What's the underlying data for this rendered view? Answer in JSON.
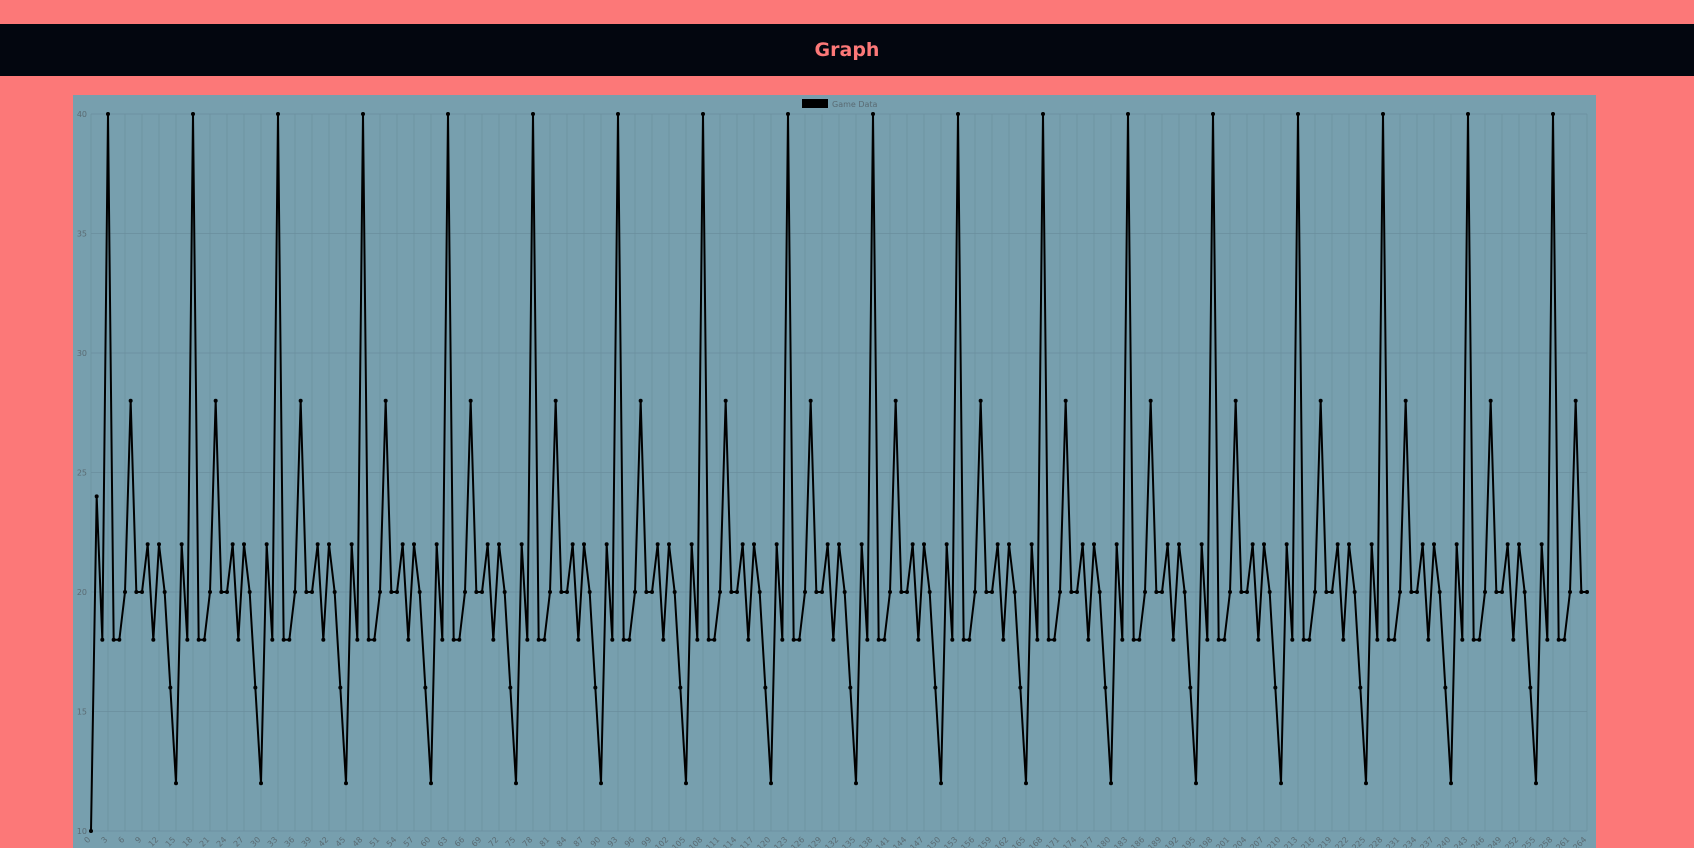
{
  "header": {
    "title": "Graph"
  },
  "colors": {
    "page_background": "#fc7878",
    "header_background": "#03060f",
    "header_text": "#fc7878",
    "chart_background": "#779fae",
    "line": "#000000",
    "grid": "#6a8e9c"
  },
  "chart_data": {
    "type": "line",
    "legend": {
      "label": "Game Data",
      "position": "top"
    },
    "grid": true,
    "ylim": [
      10,
      40
    ],
    "y_ticks": [
      10,
      15,
      20,
      25,
      30,
      35,
      40
    ],
    "x_tick_step": 3,
    "x_start": 0,
    "series": [
      {
        "name": "Game Data",
        "values": [
          10,
          24,
          18,
          40,
          18,
          18,
          20,
          28,
          20,
          20,
          22,
          18,
          22,
          20,
          16,
          12,
          22,
          18,
          40,
          18,
          18,
          20,
          28,
          20,
          20,
          22,
          18,
          22,
          20,
          16,
          12,
          22,
          18,
          40,
          18,
          18,
          20,
          28,
          20,
          20,
          22,
          18,
          22,
          20,
          16,
          12,
          22,
          18,
          40,
          18,
          18,
          20,
          28,
          20,
          20,
          22,
          18,
          22,
          20,
          16,
          12,
          22,
          18,
          40,
          18,
          18,
          20,
          28,
          20,
          20,
          22,
          18,
          22,
          20,
          16,
          12,
          22,
          18,
          40,
          18,
          18,
          20,
          28,
          20,
          20,
          22,
          18,
          22,
          20,
          16,
          12,
          22,
          18,
          40,
          18,
          18,
          20,
          28,
          20,
          20,
          22,
          18,
          22,
          20,
          16,
          12,
          22,
          18,
          40,
          18,
          18,
          20,
          28,
          20,
          20,
          22,
          18,
          22,
          20,
          16,
          12,
          22,
          18,
          40,
          18,
          18,
          20,
          28,
          20,
          20,
          22,
          18,
          22,
          20,
          16,
          12,
          22,
          18,
          40,
          18,
          18,
          20,
          28,
          20,
          20,
          22,
          18,
          22,
          20,
          16,
          12,
          22,
          18,
          40,
          18,
          18,
          20,
          28,
          20,
          20,
          22,
          18,
          22,
          20,
          16,
          12,
          22,
          18,
          40,
          18,
          18,
          20,
          28,
          20,
          20,
          22,
          18,
          22,
          20,
          16,
          12,
          22,
          18,
          40,
          18,
          18,
          20,
          28,
          20,
          20,
          22,
          18,
          22,
          20,
          16,
          12,
          22,
          18,
          40,
          18,
          18,
          20,
          28,
          20,
          20,
          22,
          18,
          22,
          20,
          16,
          12,
          22,
          18,
          40,
          18,
          18,
          20,
          28,
          20,
          20,
          22,
          18,
          22,
          20,
          16,
          12,
          22,
          18,
          40,
          18,
          18,
          20,
          28,
          20,
          20,
          22,
          18,
          22,
          20,
          16,
          12,
          22,
          18,
          40,
          18,
          18,
          20,
          28,
          20,
          20,
          22,
          18,
          22,
          20,
          16,
          12,
          22,
          18,
          40,
          18,
          18,
          20,
          28,
          20,
          20
        ]
      }
    ]
  }
}
